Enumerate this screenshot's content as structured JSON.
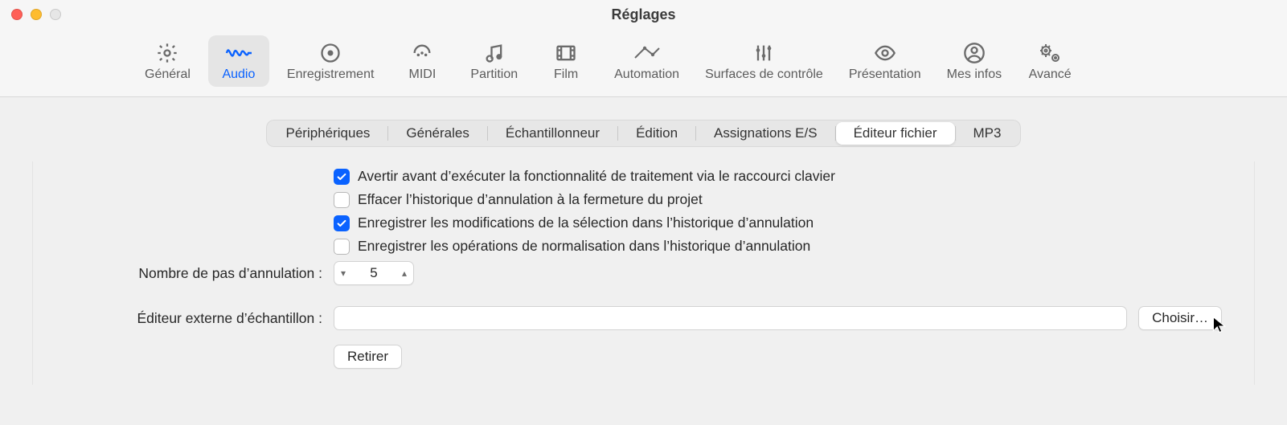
{
  "window": {
    "title": "Réglages"
  },
  "toolbar": {
    "items": [
      {
        "id": "general",
        "label": "Général"
      },
      {
        "id": "audio",
        "label": "Audio"
      },
      {
        "id": "recording",
        "label": "Enregistrement"
      },
      {
        "id": "midi",
        "label": "MIDI"
      },
      {
        "id": "score",
        "label": "Partition"
      },
      {
        "id": "movie",
        "label": "Film"
      },
      {
        "id": "automation",
        "label": "Automation"
      },
      {
        "id": "surfaces",
        "label": "Surfaces de contrôle"
      },
      {
        "id": "display",
        "label": "Présentation"
      },
      {
        "id": "myinfo",
        "label": "Mes infos"
      },
      {
        "id": "advanced",
        "label": "Avancé"
      }
    ],
    "selected": "audio"
  },
  "tabs": {
    "items": [
      "Périphériques",
      "Générales",
      "Échantillonneur",
      "Édition",
      "Assignations E/S",
      "Éditeur fichier",
      "MP3"
    ],
    "selected_index": 5
  },
  "options": {
    "warn_before_process": {
      "label": "Avertir avant d’exécuter la fonctionnalité de traitement via le raccourci clavier",
      "checked": true
    },
    "clear_undo_on_close": {
      "label": "Effacer l’historique d’annulation à la fermeture du projet",
      "checked": false
    },
    "record_selection_undo": {
      "label": "Enregistrer les modifications de la sélection dans l’historique d’annulation",
      "checked": true
    },
    "record_normalize_undo": {
      "label": "Enregistrer les opérations de normalisation dans l’historique d’annulation",
      "checked": false
    }
  },
  "undo_steps": {
    "label": "Nombre de pas d’annulation :",
    "value": "5"
  },
  "external_editor": {
    "label": "Éditeur externe d’échantillon :",
    "value": "",
    "choose_label": "Choisir…",
    "remove_label": "Retirer"
  }
}
